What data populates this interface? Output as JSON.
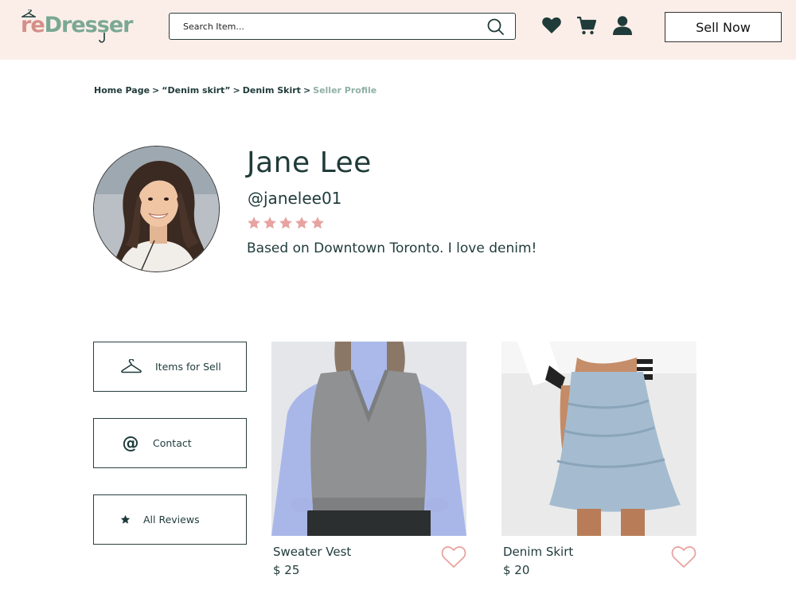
{
  "header": {
    "logo": {
      "prefix": "re",
      "suffix": "Dresser"
    },
    "search": {
      "placeholder": "Search Item..."
    },
    "sell_label": "Sell Now",
    "icons": [
      "search-icon",
      "heart-icon",
      "cart-icon",
      "user-icon"
    ]
  },
  "breadcrumb": {
    "items": [
      "Home Page",
      "“Denim skirt”",
      "Denim Skirt"
    ],
    "current": "Seller Profile",
    "separator": ">"
  },
  "profile": {
    "name": "Jane Lee",
    "handle": "@janelee01",
    "rating": 5,
    "rating_max": 5,
    "bio": "Based on Downtown Toronto. I love denim!"
  },
  "menu": [
    {
      "label": "Items for Sell",
      "icon": "hanger-icon"
    },
    {
      "label": "Contact",
      "icon": "at-sign-icon"
    },
    {
      "label": "All Reviews",
      "icon": "star-icon"
    }
  ],
  "products": [
    {
      "title": "Sweater Vest",
      "price": "$ 25"
    },
    {
      "title": "Denim Skirt",
      "price": "$ 20"
    }
  ],
  "colors": {
    "header_bg": "#fbeee8",
    "text": "#1f3b3a",
    "accent_pink": "#e7a3a0",
    "accent_green": "#7aa894",
    "breadcrumb_current": "#8fb0a4"
  }
}
